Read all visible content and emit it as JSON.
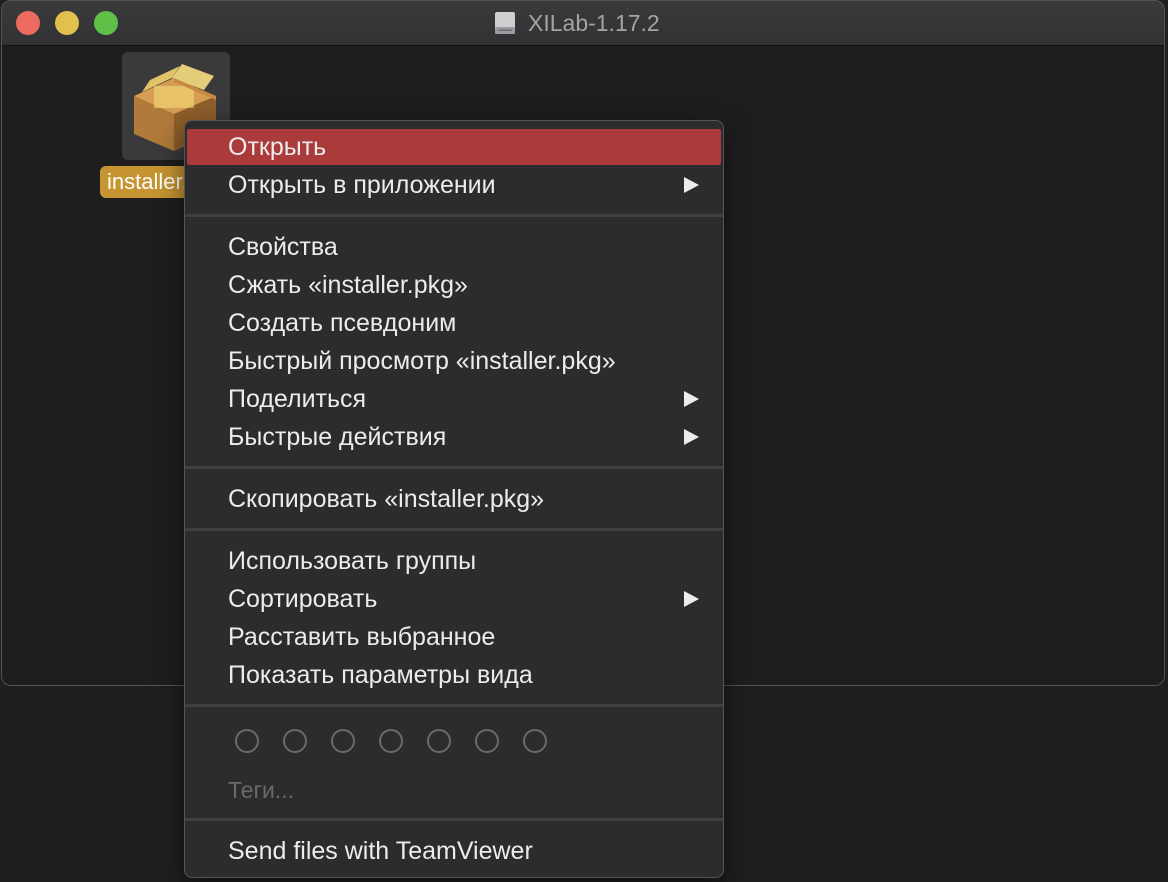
{
  "window": {
    "title": "XILab-1.17.2"
  },
  "file": {
    "label": "installer.pkg",
    "icon": "package-icon"
  },
  "menu": {
    "items": {
      "open": "Открыть",
      "open_with": "Открыть в приложении",
      "properties": "Свойства",
      "compress": "Сжать «installer.pkg»",
      "make_alias": "Создать псевдоним",
      "quick_look": "Быстрый просмотр «installer.pkg»",
      "share": "Поделиться",
      "quick_actions": "Быстрые действия",
      "copy": "Скопировать «installer.pkg»",
      "use_groups": "Использовать группы",
      "sort": "Сортировать",
      "clean_up": "Расставить выбранное",
      "view_options": "Показать параметры вида",
      "tags": "Теги...",
      "teamviewer": "Send files with TeamViewer"
    },
    "highlight_color": "#ab3a3b"
  },
  "colors": {
    "close": "#ec6a5e",
    "minimize": "#e2c04c",
    "maximize": "#5fc048",
    "file_label_bg": "#c69531"
  }
}
